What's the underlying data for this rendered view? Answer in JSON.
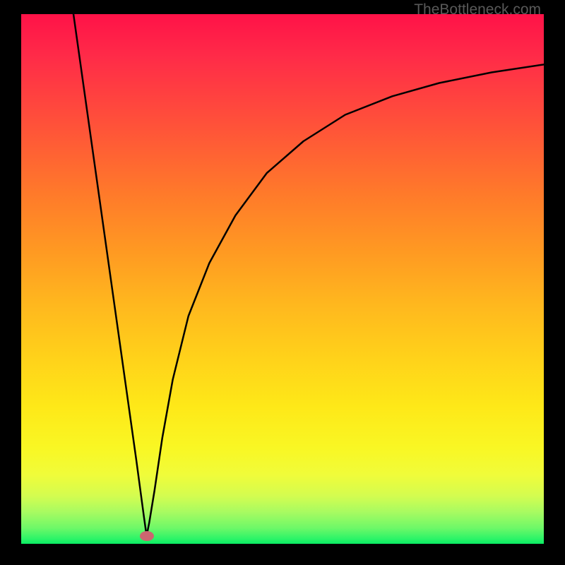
{
  "watermark": "TheBottleneck.com",
  "chart_data": {
    "type": "line",
    "title": "",
    "xlabel": "",
    "ylabel": "",
    "xlim": [
      0,
      100
    ],
    "ylim": [
      0,
      100
    ],
    "series": [
      {
        "name": "curve",
        "x": [
          10,
          12,
          14,
          16,
          18,
          20,
          22,
          23.5,
          24,
          24.5,
          25.5,
          27,
          29,
          32,
          36,
          41,
          47,
          54,
          62,
          71,
          80,
          90,
          100
        ],
        "y": [
          100,
          86,
          72,
          58,
          44,
          30,
          16,
          5,
          1.5,
          4,
          10,
          20,
          31,
          43,
          53,
          62,
          70,
          76,
          81,
          84.5,
          87,
          89,
          90.5
        ]
      }
    ],
    "marker": {
      "x": 24,
      "y": 1.5
    },
    "background_gradient": {
      "top": "#ff1248",
      "mid": "#ffd21a",
      "bottom": "#0aec63"
    }
  }
}
